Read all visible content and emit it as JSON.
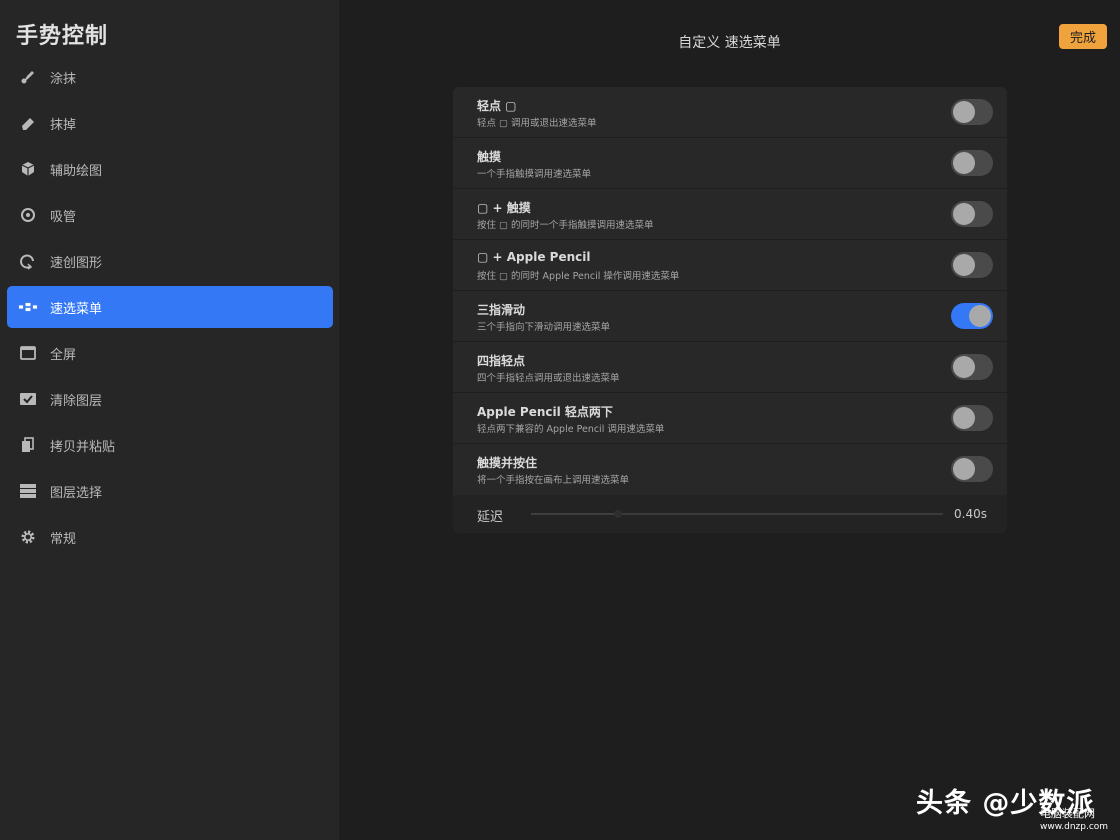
{
  "sidebar": {
    "title": "手势控制",
    "items": [
      {
        "label": "涂抹",
        "icon": "smudge-brush-icon",
        "active": false
      },
      {
        "label": "抹掉",
        "icon": "eraser-icon",
        "active": false
      },
      {
        "label": "辅助绘图",
        "icon": "cube-icon",
        "active": false
      },
      {
        "label": "吸管",
        "icon": "eyedropper-circle-icon",
        "active": false
      },
      {
        "label": "速创图形",
        "icon": "quickshape-icon",
        "active": false
      },
      {
        "label": "速选菜单",
        "icon": "quickmenu-icon",
        "active": true
      },
      {
        "label": "全屏",
        "icon": "fullscreen-icon",
        "active": false
      },
      {
        "label": "清除图层",
        "icon": "clear-layer-icon",
        "active": false
      },
      {
        "label": "拷贝并粘贴",
        "icon": "copy-paste-icon",
        "active": false
      },
      {
        "label": "图层选择",
        "icon": "layer-select-icon",
        "active": false
      },
      {
        "label": "常规",
        "icon": "gear-icon",
        "active": false
      }
    ]
  },
  "header": {
    "title": "自定义 速选菜单",
    "done_label": "完成"
  },
  "settings": [
    {
      "title": "轻点 ▢",
      "subtitle": "轻点 ▢ 调用或退出速选菜单",
      "enabled": false
    },
    {
      "title": "触摸",
      "subtitle": "一个手指触摸调用速选菜单",
      "enabled": false
    },
    {
      "title": "▢ + 触摸",
      "subtitle": "按住 ▢ 的同时一个手指触摸调用速选菜单",
      "enabled": false
    },
    {
      "title": "▢ + Apple Pencil",
      "subtitle": "按住 ▢ 的同时 Apple Pencil 操作调用速选菜单",
      "enabled": false
    },
    {
      "title": "三指滑动",
      "subtitle": "三个手指向下滑动调用速选菜单",
      "enabled": true
    },
    {
      "title": "四指轻点",
      "subtitle": "四个手指轻点调用或退出速选菜单",
      "enabled": false
    },
    {
      "title": "Apple Pencil 轻点两下",
      "subtitle": "轻点两下兼容的 Apple Pencil 调用速选菜单",
      "enabled": false
    },
    {
      "title": "触摸并按住",
      "subtitle": "将一个手指按在画布上调用速选菜单",
      "enabled": false
    }
  ],
  "delay": {
    "label": "延迟",
    "value": "0.40s",
    "level": 0.21
  },
  "watermark": {
    "text": "头条 @少数派",
    "site": "电脑装配网",
    "url": "www.dnzp.com"
  },
  "colors": {
    "accent": "#3478f6",
    "done_button": "#f0a33c"
  }
}
